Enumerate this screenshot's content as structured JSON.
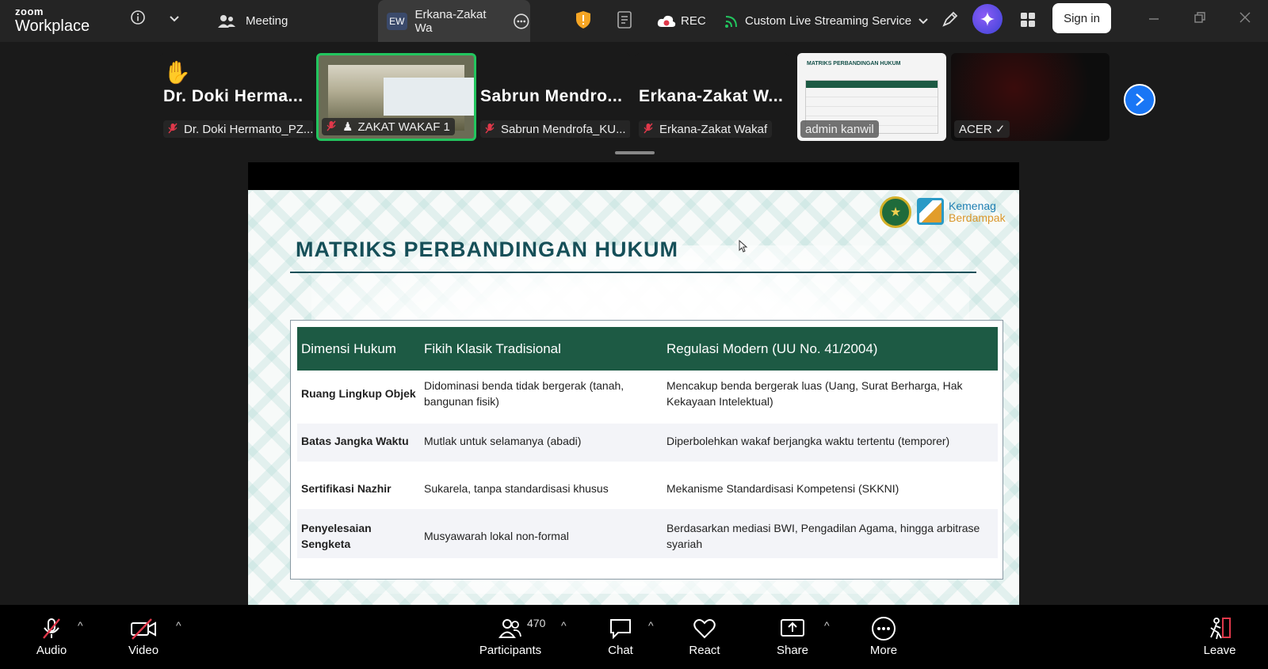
{
  "app": {
    "logo_line1": "zoom",
    "logo_line2": "Workplace"
  },
  "topbar": {
    "meeting_tab": "Meeting",
    "active_tab": {
      "initials": "EW",
      "label": "Erkana-Zakat Wa"
    },
    "rec_label": "REC",
    "stream_label": "Custom Live Streaming Service",
    "sign_in": "Sign in"
  },
  "participants_strip": [
    {
      "big_name": "Dr. Doki Herma...",
      "nameplate": "Dr. Doki Hermanto_PZ...",
      "raised_hand": true
    },
    {
      "nameplate": "ZAKAT WAKAF 1",
      "video": true
    },
    {
      "big_name": "Sabrun  Mendro...",
      "nameplate": "Sabrun Mendrofa_KU..."
    },
    {
      "big_name": "Erkana-Zakat  W...",
      "nameplate": "Erkana-Zakat Wakaf"
    },
    {
      "nameplate": "admin kanwil",
      "thumb_title": "MATRIKS PERBANDINGAN HUKUM"
    },
    {
      "nameplate": "ACER ✓"
    }
  ],
  "slide": {
    "title": "MATRIKS PERBANDINGAN HUKUM",
    "brand_line1": "Kemenag",
    "brand_line2": "Berdampak",
    "table": {
      "headers": [
        "Dimensi Hukum",
        "Fikih Klasik Tradisional",
        "Regulasi Modern (UU No. 41/2004)"
      ],
      "rows": [
        [
          "Ruang Lingkup Objek",
          "Didominasi benda tidak bergerak (tanah, bangunan fisik)",
          "Mencakup benda bergerak luas (Uang, Surat Berharga, Hak Kekayaan Intelektual)"
        ],
        [
          "Batas Jangka Waktu",
          "Mutlak untuk selamanya (abadi)",
          "Diperbolehkan wakaf berjangka waktu tertentu (temporer)"
        ],
        [
          "Sertifikasi Nazhir",
          "Sukarela, tanpa standardisasi khusus",
          "Mekanisme Standardisasi Kompetensi (SKKNI)"
        ],
        [
          "Penyelesaian Sengketa",
          "Musyawarah lokal non-formal",
          "Berdasarkan mediasi BWI, Pengadilan Agama, hingga arbitrase syariah"
        ]
      ]
    }
  },
  "toolbar": {
    "audio": "Audio",
    "video": "Video",
    "participants": "Participants",
    "participant_count": "470",
    "chat": "Chat",
    "react": "React",
    "share": "Share",
    "more": "More",
    "leave": "Leave"
  }
}
